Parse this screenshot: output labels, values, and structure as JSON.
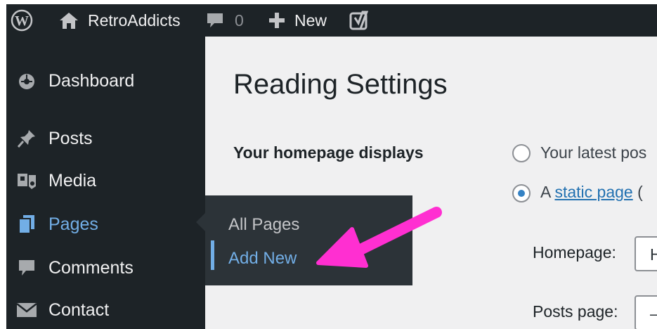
{
  "admin_bar": {
    "site_name": "RetroAddicts",
    "comments_count": "0",
    "new_label": "New"
  },
  "sidebar": {
    "items": [
      {
        "label": "Dashboard",
        "icon": "dashboard-icon"
      },
      {
        "label": "Posts",
        "icon": "pushpin-icon"
      },
      {
        "label": "Media",
        "icon": "media-icon"
      },
      {
        "label": "Pages",
        "icon": "pages-icon",
        "active": true
      },
      {
        "label": "Comments",
        "icon": "comment-icon"
      },
      {
        "label": "Contact",
        "icon": "envelope-icon"
      }
    ],
    "pages_submenu": [
      {
        "label": "All Pages"
      },
      {
        "label": "Add New",
        "current": true
      }
    ]
  },
  "main": {
    "title": "Reading Settings",
    "homepage_displays": {
      "label": "Your homepage displays",
      "option_latest_posts": "Your latest pos",
      "option_static_prefix": "A",
      "option_static_link": "static page",
      "option_static_suffix": "(",
      "selected": "static page"
    },
    "homepage_select": {
      "label": "Homepage:",
      "value": "H"
    },
    "posts_page_select": {
      "label": "Posts page:",
      "value": "—"
    }
  },
  "annotation": {
    "arrow_color": "#ff2fd1"
  },
  "colors": {
    "admin_bar_bg": "#1d2327",
    "sidebar_bg": "#1d2327",
    "submenu_bg": "#2c3338",
    "accent_blue": "#72aee6",
    "content_bg": "#f0f0f1"
  }
}
